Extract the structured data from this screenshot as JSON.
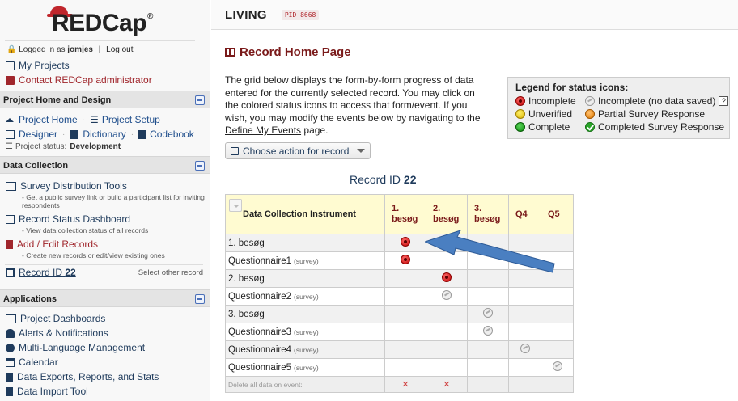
{
  "sidebar": {
    "logo_text": "REDCap",
    "logo_reg": "®",
    "login": {
      "prefix": "Logged in as",
      "user": "jomjes",
      "sep": "|",
      "logout": "Log out"
    },
    "top_links": [
      {
        "label": "My Projects",
        "icon": "projects-icon"
      },
      {
        "label": "Contact REDCap administrator",
        "icon": "mail-icon"
      }
    ],
    "project_home_design": {
      "header": "Project Home and Design",
      "project_home": "Project Home",
      "project_setup": "Project Setup",
      "designer": "Designer",
      "dictionary": "Dictionary",
      "codebook": "Codebook",
      "status_label": "Project status:",
      "status_value": "Development"
    },
    "data_collection": {
      "header": "Data Collection",
      "survey_tools": "Survey Distribution Tools",
      "survey_tools_sub": "- Get a public survey link or build a participant list for inviting respondents",
      "record_status": "Record Status Dashboard",
      "record_status_sub": "- View data collection status of all records",
      "add_edit": "Add / Edit Records",
      "add_edit_sub": "- Create new records or edit/view existing ones",
      "record_id_label": "Record ID",
      "record_id_value": "22",
      "select_other": "Select other record"
    },
    "applications": {
      "header": "Applications",
      "items": [
        "Project Dashboards",
        "Alerts & Notifications",
        "Multi-Language Management",
        "Calendar",
        "Data Exports, Reports, and Stats",
        "Data Import Tool"
      ]
    }
  },
  "topbar": {
    "title": "LIVING",
    "pid": "PID 8668"
  },
  "main": {
    "page_title": "Record Home Page",
    "intro_before": "The grid below displays the form-by-form progress of data entered for the currently selected record. You may click on the colored status icons to access that form/event. If you wish, you may modify the events below by navigating to the",
    "intro_link": "Define My Events",
    "intro_after": "page.",
    "choose_action": "Choose action for record",
    "record_id_label": "Record ID",
    "record_id_value": "22"
  },
  "legend": {
    "title": "Legend for status icons:",
    "items": [
      {
        "label": "Incomplete",
        "icon": "red"
      },
      {
        "label": "Incomplete (no data saved)",
        "icon": "gray"
      },
      {
        "label": "Unverified",
        "icon": "yellow"
      },
      {
        "label": "Partial Survey Response",
        "icon": "orange"
      },
      {
        "label": "Complete",
        "icon": "green"
      },
      {
        "label": "Completed Survey Response",
        "icon": "green-check"
      }
    ],
    "help": "?"
  },
  "grid": {
    "instrument_header": "Data Collection Instrument",
    "events": [
      "1. besøg",
      "2. besøg",
      "3. besøg",
      "Q4",
      "Q5"
    ],
    "survey_tag": "(survey)",
    "rows": [
      {
        "name": "1. besøg",
        "survey": false,
        "status": [
          "red",
          "",
          "",
          "",
          ""
        ]
      },
      {
        "name": "Questionnaire1",
        "survey": true,
        "status": [
          "red",
          "",
          "",
          "",
          ""
        ]
      },
      {
        "name": "2. besøg",
        "survey": false,
        "status": [
          "",
          "red",
          "",
          "",
          ""
        ]
      },
      {
        "name": "Questionnaire2",
        "survey": true,
        "status": [
          "",
          "gray",
          "",
          "",
          ""
        ]
      },
      {
        "name": "3. besøg",
        "survey": false,
        "status": [
          "",
          "",
          "gray",
          "",
          ""
        ]
      },
      {
        "name": "Questionnaire3",
        "survey": true,
        "status": [
          "",
          "",
          "gray",
          "",
          ""
        ]
      },
      {
        "name": "Questionnaire4",
        "survey": true,
        "status": [
          "",
          "",
          "",
          "gray",
          ""
        ]
      },
      {
        "name": "Questionnaire5",
        "survey": true,
        "status": [
          "",
          "",
          "",
          "",
          "gray"
        ]
      }
    ],
    "delete_label": "Delete all data on event:",
    "delete_marks": [
      "✕",
      "✕",
      "",
      "",
      ""
    ]
  },
  "colors": {
    "brand_red": "#c0262c",
    "title_red": "#7a1a1a",
    "link_blue": "#1f3b5c",
    "arrow_blue": "#4a7fc1",
    "header_yellow": "#fffbd1"
  }
}
